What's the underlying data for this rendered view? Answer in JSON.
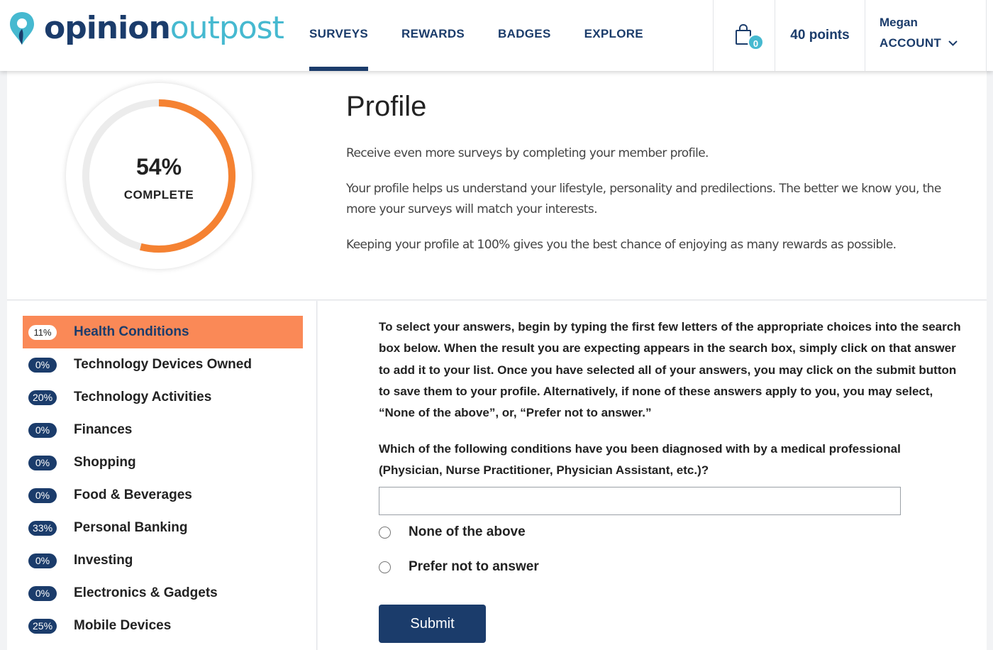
{
  "brand": {
    "name_part1": "opinion",
    "name_part2": "outpost",
    "primary": "#1b3c6b",
    "accent": "#46b9d0",
    "orange": "#fa8957"
  },
  "nav": [
    {
      "label": "SURVEYS",
      "active": true
    },
    {
      "label": "REWARDS"
    },
    {
      "label": "BADGES"
    },
    {
      "label": "EXPLORE"
    }
  ],
  "cart": {
    "icon": "shopping-bag-icon",
    "count": "0"
  },
  "points": "40 points",
  "account": {
    "name": "Megan",
    "label": "ACCOUNT"
  },
  "progress": {
    "percent_text": "54%",
    "label": "COMPLETE",
    "value": 0.54
  },
  "profile": {
    "title": "Profile",
    "text1": "Receive even more surveys by completing your member profile.",
    "text2": "Your profile helps us understand your lifestyle, personality and predilections. The better we know you, the more your surveys will match your interests.",
    "text3": "Keeping your profile at 100% gives you the best chance of enjoying as many rewards as possible."
  },
  "categories": [
    {
      "pct": "11%",
      "label": "Health Conditions",
      "active": true
    },
    {
      "pct": "0%",
      "label": "Technology Devices Owned"
    },
    {
      "pct": "20%",
      "label": "Technology Activities"
    },
    {
      "pct": "0%",
      "label": "Finances"
    },
    {
      "pct": "0%",
      "label": "Shopping"
    },
    {
      "pct": "0%",
      "label": "Food & Beverages"
    },
    {
      "pct": "33%",
      "label": "Personal Banking"
    },
    {
      "pct": "0%",
      "label": "Investing"
    },
    {
      "pct": "0%",
      "label": "Electronics & Gadgets"
    },
    {
      "pct": "25%",
      "label": "Mobile Devices"
    }
  ],
  "survey": {
    "instructions": "To select your answers, begin by typing the first few letters of the appropriate choices into the search box below. When the result you are expecting appears in the search box, simply click on that answer to add it to your list. Once you have selected all of your answers, you may click on the submit button to save them to your profile. Alternatively, if none of these answers apply to you, you may select, “None of the above”, or, “Prefer not to answer.”",
    "question": "Which of the following conditions have you been diagnosed with by a medical professional (Physician, Nurse Practitioner, Physician Assistant, etc.)?",
    "search_value": "",
    "option_none": "None of the above",
    "option_prefer": "Prefer not to answer",
    "submit_label": "Submit"
  }
}
